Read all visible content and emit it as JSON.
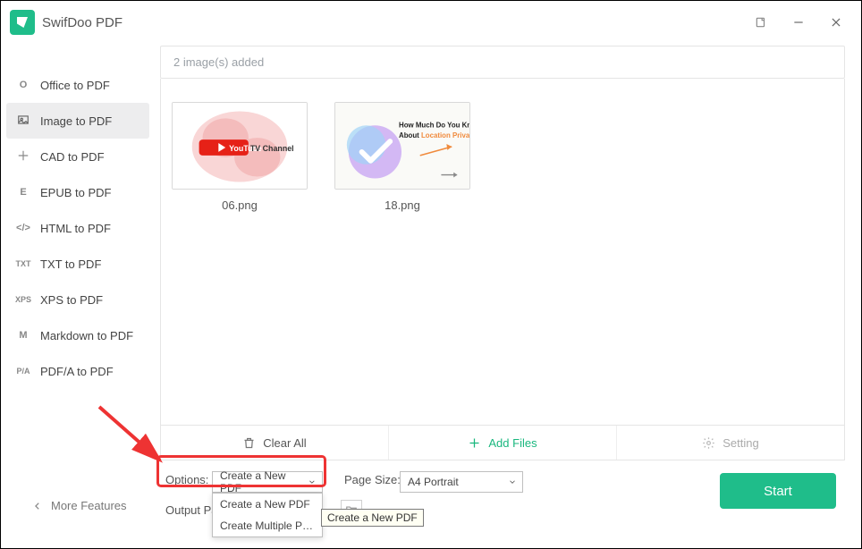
{
  "app": {
    "title": "SwifDoo PDF"
  },
  "sidebar": {
    "items": [
      {
        "icon": "O",
        "label": "Office to PDF"
      },
      {
        "icon": "img",
        "label": "Image to PDF"
      },
      {
        "icon": "cad",
        "label": "CAD to PDF"
      },
      {
        "icon": "E",
        "label": "EPUB to PDF"
      },
      {
        "icon": "</>",
        "label": "HTML to PDF"
      },
      {
        "icon": "TXT",
        "label": "TXT to PDF"
      },
      {
        "icon": "XPS",
        "label": "XPS to PDF"
      },
      {
        "icon": "M",
        "label": "Markdown to PDF"
      },
      {
        "icon": "P/A",
        "label": "PDF/A to PDF"
      }
    ],
    "active_index": 1
  },
  "content": {
    "status": "2 image(s) added",
    "thumbs": [
      {
        "caption": "06.png"
      },
      {
        "caption": "18.png"
      }
    ],
    "thumb18": {
      "line1": "How Much Do You Know",
      "line2a": "About ",
      "line2b": "Location Privacy"
    }
  },
  "actions": {
    "clear": "Clear All",
    "add": "Add Files",
    "setting": "Setting"
  },
  "bottom": {
    "more": "More Features",
    "options_label": "Options:",
    "options_value": "Create a New PDF",
    "dropdown": [
      "Create a New PDF",
      "Create Multiple PDF ..."
    ],
    "tooltip": "Create a New PDF",
    "pagesize_label": "Page Size:",
    "pagesize_value": "A4 Portrait",
    "output_label": "Output Pat",
    "start": "Start"
  },
  "youtube": {
    "brand": "YouTube",
    "suffix": " TV Channel"
  }
}
